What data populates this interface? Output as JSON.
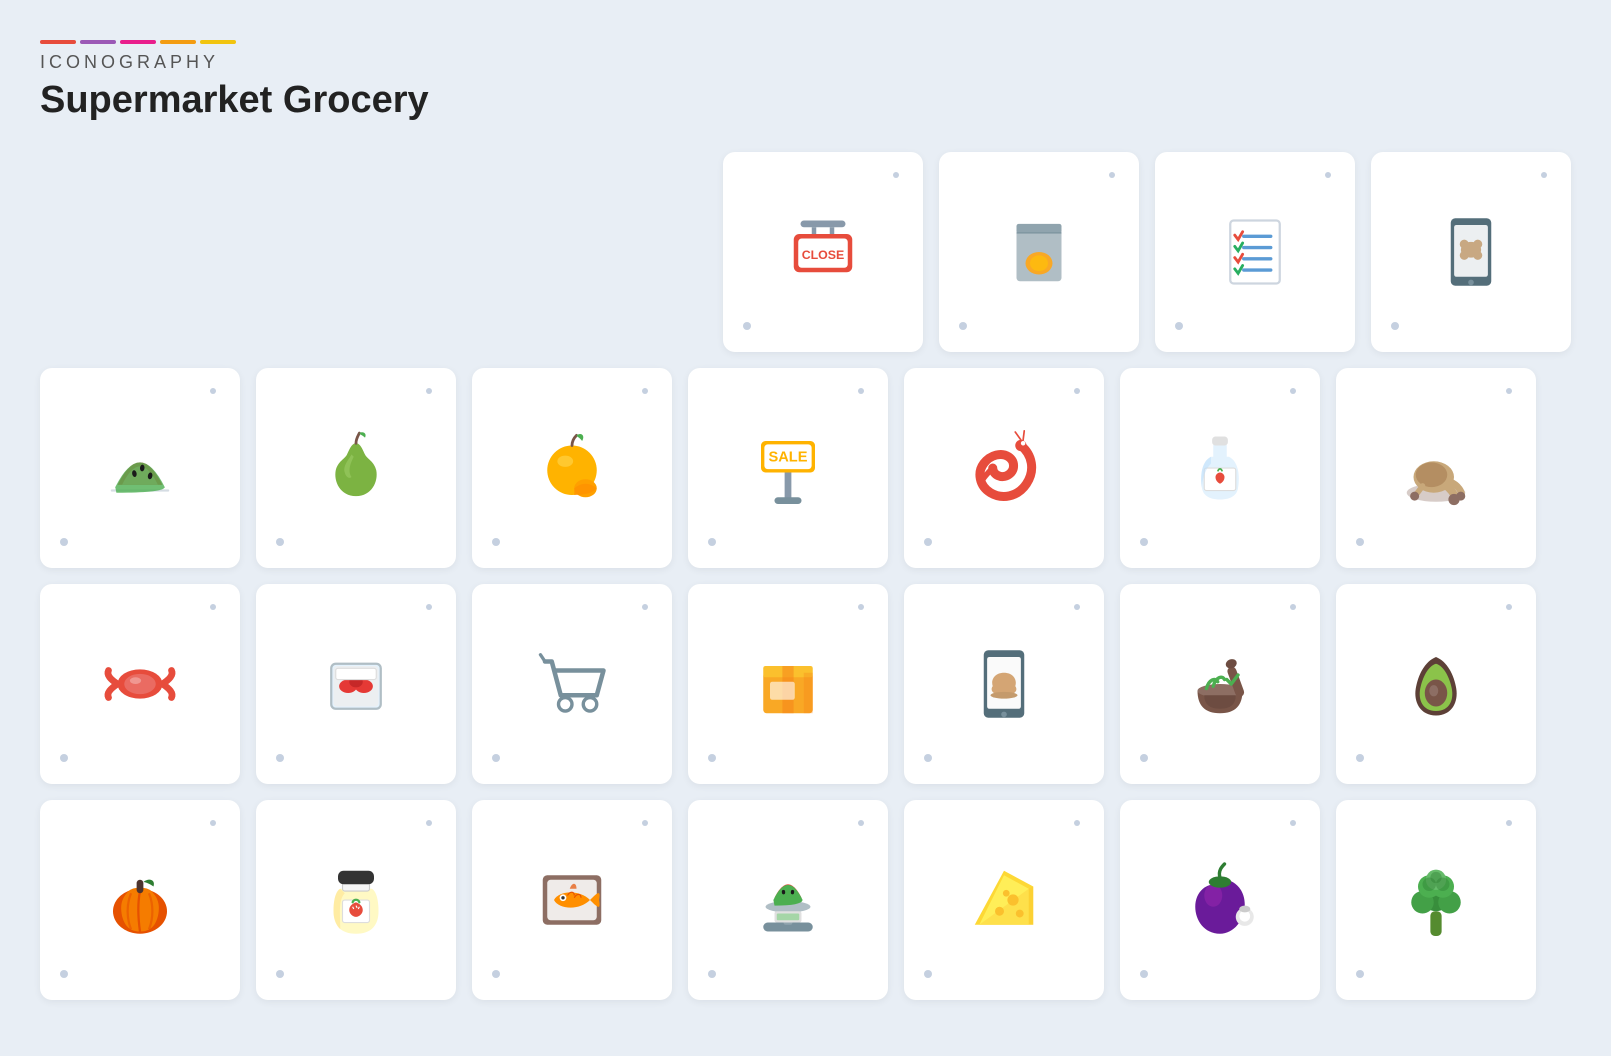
{
  "header": {
    "brand": "ICONOGRAPHY",
    "title": "Supermarket Grocery",
    "logo_colors": [
      "#e74c3c",
      "#9b59b6",
      "#e91e8c",
      "#f39c12",
      "#f1c40f"
    ]
  },
  "icons": {
    "row1": [
      {
        "name": "close-sign",
        "label": "Close Sign"
      },
      {
        "name": "powder-box",
        "label": "Powder Box"
      },
      {
        "name": "checklist",
        "label": "Checklist"
      },
      {
        "name": "meat-tablet",
        "label": "Meat Tablet"
      }
    ],
    "row2": [
      {
        "name": "watermelon",
        "label": "Watermelon"
      },
      {
        "name": "pear",
        "label": "Pear"
      },
      {
        "name": "orange",
        "label": "Orange"
      },
      {
        "name": "sale-sign",
        "label": "Sale Sign"
      },
      {
        "name": "shrimp",
        "label": "Shrimp"
      },
      {
        "name": "sauce-bottle",
        "label": "Sauce Bottle"
      },
      {
        "name": "roast-chicken",
        "label": "Roast Chicken"
      }
    ],
    "row3": [
      {
        "name": "candy",
        "label": "Candy"
      },
      {
        "name": "meat-package",
        "label": "Meat Package"
      },
      {
        "name": "shopping-cart",
        "label": "Shopping Cart"
      },
      {
        "name": "box",
        "label": "Box"
      },
      {
        "name": "bread-tablet",
        "label": "Bread Tablet"
      },
      {
        "name": "mortar-pestle",
        "label": "Mortar Pestle"
      },
      {
        "name": "avocado",
        "label": "Avocado"
      }
    ],
    "row4": [
      {
        "name": "pumpkin",
        "label": "Pumpkin"
      },
      {
        "name": "jam-jar",
        "label": "Jam Jar"
      },
      {
        "name": "fish-frame",
        "label": "Fish Frame"
      },
      {
        "name": "watermelon-scale",
        "label": "Watermelon Scale"
      },
      {
        "name": "cheese",
        "label": "Cheese"
      },
      {
        "name": "eggplant",
        "label": "Eggplant"
      },
      {
        "name": "broccoli",
        "label": "Broccoli"
      }
    ]
  }
}
